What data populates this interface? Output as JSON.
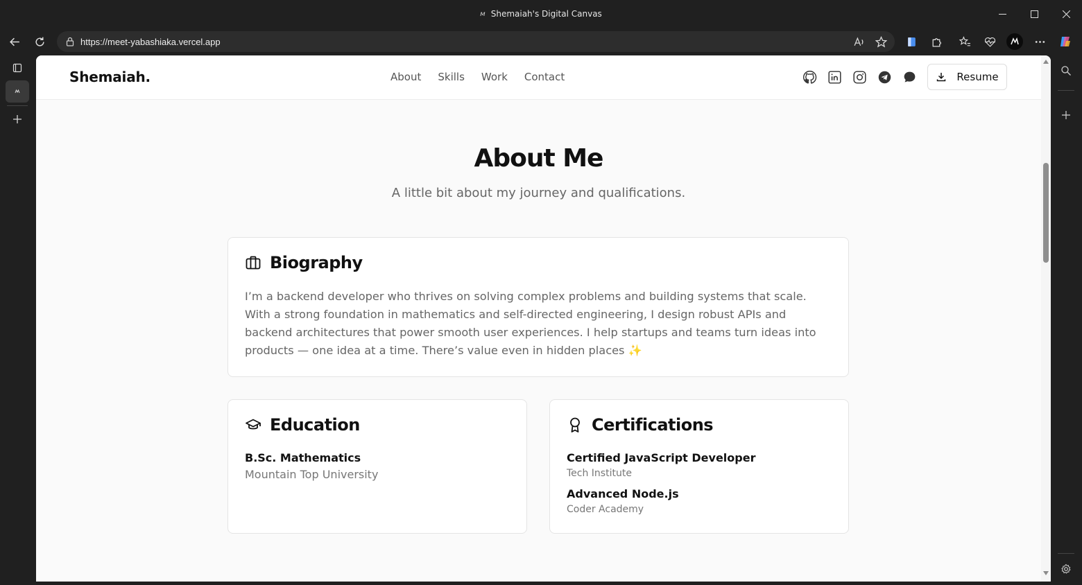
{
  "browser": {
    "window_title": "Shemaiah's Digital Canvas",
    "url": "https://meet-yabashiaka.vercel.app"
  },
  "site": {
    "brand": "Shemaiah.",
    "nav": [
      "About",
      "Skills",
      "Work",
      "Contact"
    ],
    "socials": [
      "github-icon",
      "linkedin-icon",
      "instagram-icon",
      "telegram-icon",
      "chat-icon"
    ],
    "resume_label": "Resume"
  },
  "about": {
    "title": "About Me",
    "subtitle": "A little bit about my journey and qualifications.",
    "biography": {
      "heading": "Biography",
      "text": "I’m a backend developer who thrives on solving complex problems and building systems that scale. With a strong foundation in mathematics and self-directed engineering, I design robust APIs and backend architectures that power smooth user experiences. I help startups and teams turn ideas into products — one idea at a time. There’s value even in hidden places ✨"
    },
    "education": {
      "heading": "Education",
      "items": [
        {
          "degree": "B.Sc. Mathematics",
          "school": "Mountain Top University"
        }
      ]
    },
    "certifications": {
      "heading": "Certifications",
      "items": [
        {
          "name": "Certified JavaScript Developer",
          "issuer": "Tech Institute"
        },
        {
          "name": "Advanced Node.js",
          "issuer": "Coder Academy"
        }
      ]
    }
  }
}
